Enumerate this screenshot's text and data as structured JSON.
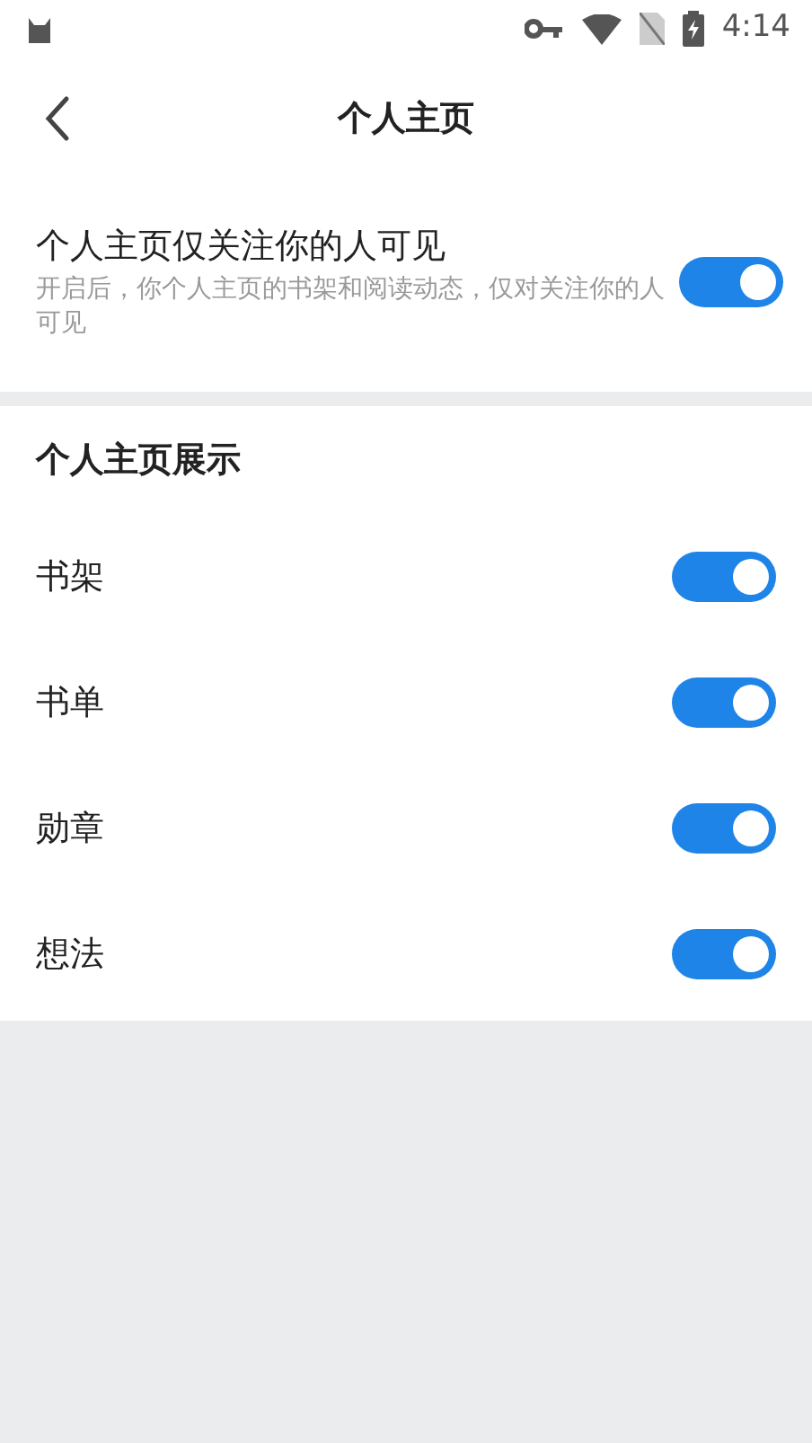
{
  "status_bar": {
    "time": "4:14"
  },
  "header": {
    "title": "个人主页"
  },
  "privacy": {
    "title": "个人主页仅关注你的人可见",
    "description": "开启后，你个人主页的书架和阅读动态，仅对关注你的人可见",
    "on": true
  },
  "display": {
    "heading": "个人主页展示",
    "items": [
      {
        "label": "书架",
        "on": true
      },
      {
        "label": "书单",
        "on": true
      },
      {
        "label": "勋章",
        "on": true
      },
      {
        "label": "想法",
        "on": true
      }
    ]
  }
}
